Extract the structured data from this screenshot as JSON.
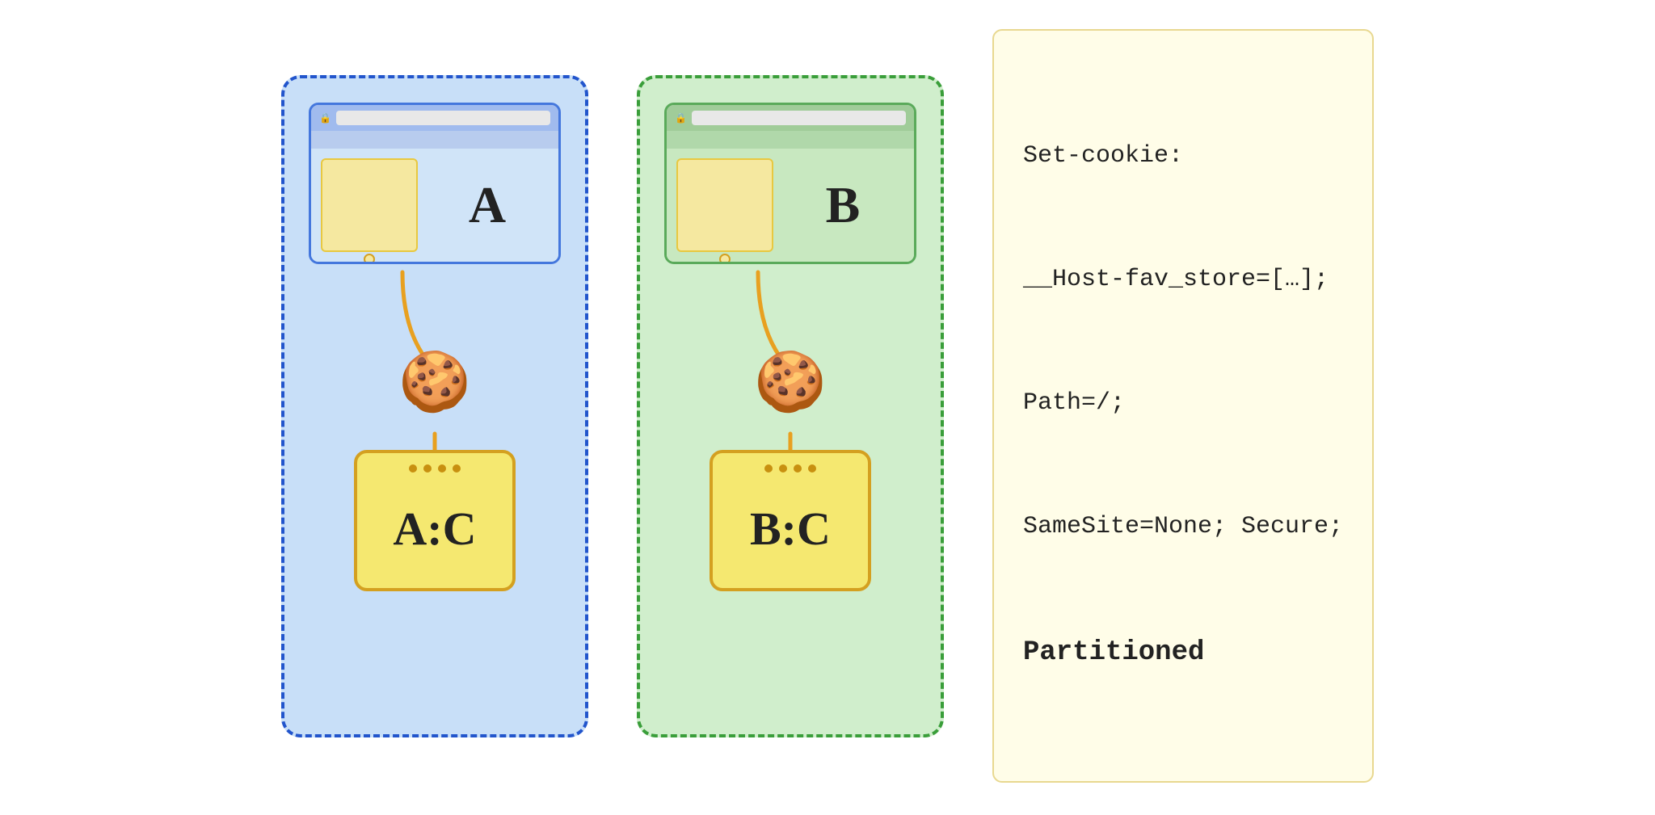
{
  "diagram": {
    "left_box": {
      "label": "A",
      "storage_label": "A:C",
      "border_color": "#2255cc",
      "bg_color": "#c8dff8",
      "browser_theme": "blue"
    },
    "right_box": {
      "label": "B",
      "storage_label": "B:C",
      "border_color": "#3a9e3a",
      "bg_color": "#d0eecc",
      "browser_theme": "green"
    },
    "cookie_emoji": "🍪",
    "code_block": {
      "lines": [
        "Set-cookie:",
        "__Host-fav_store=[…];",
        "Path=/;",
        "SameSite=None; Secure;",
        "Partitioned"
      ]
    }
  }
}
